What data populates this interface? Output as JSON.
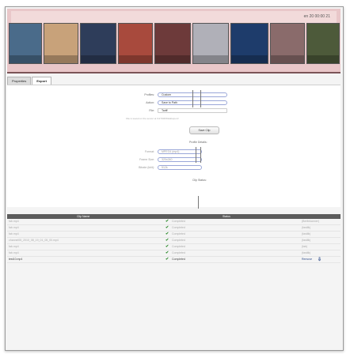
{
  "filmstrip": {
    "timestamp": "en 20 00:00 21"
  },
  "tabs": [
    "Properties",
    "Export"
  ],
  "form": {
    "profiles_label": "Profiles:",
    "profiles_value": "Custom",
    "action_label": "Action:",
    "action_value": "Save to Path",
    "file_label": "File:",
    "file_value": "Tariff",
    "hint": "File is saved on the server at /12700/F8Hd/export/",
    "save_button": "Save Clip",
    "profile_details": "Profile Details:",
    "format_label": "Format:",
    "format_value": "MPEG4 (mp4)",
    "frame_size_label": "Frame Size:",
    "frame_size_value": "320x240",
    "bitrate_label": "Bitrate (kbit):",
    "bitrate_value": "512k",
    "clip_status": "Clip Status:"
  },
  "cliplist": {
    "headers": [
      "Clip Name",
      "Status",
      ""
    ],
    "rows": [
      {
        "name": "fab.mp4",
        "status": "Completed",
        "user": "(Berlinkanner)",
        "check": "✔"
      },
      {
        "name": "fab.mp4",
        "status": "Completed",
        "user": "(fastilk)",
        "check": "✔"
      },
      {
        "name": "fab.mp4",
        "status": "Completed",
        "user": "(fastilk)",
        "check": "✔"
      },
      {
        "name": "channel05_2010_08_19_01_05_00.mp4",
        "status": "Completed",
        "user": "(fastilk)",
        "check": "✔"
      },
      {
        "name": "fab.mp4",
        "status": "Completed",
        "user": "(fab)",
        "check": "✔"
      },
      {
        "name": "fab.mp4",
        "status": "Completed",
        "user": "(fastilk)",
        "check": "✔"
      },
      {
        "name": "test10.mp4",
        "status": "Completed",
        "user": "Remove",
        "check": "✔"
      }
    ]
  }
}
